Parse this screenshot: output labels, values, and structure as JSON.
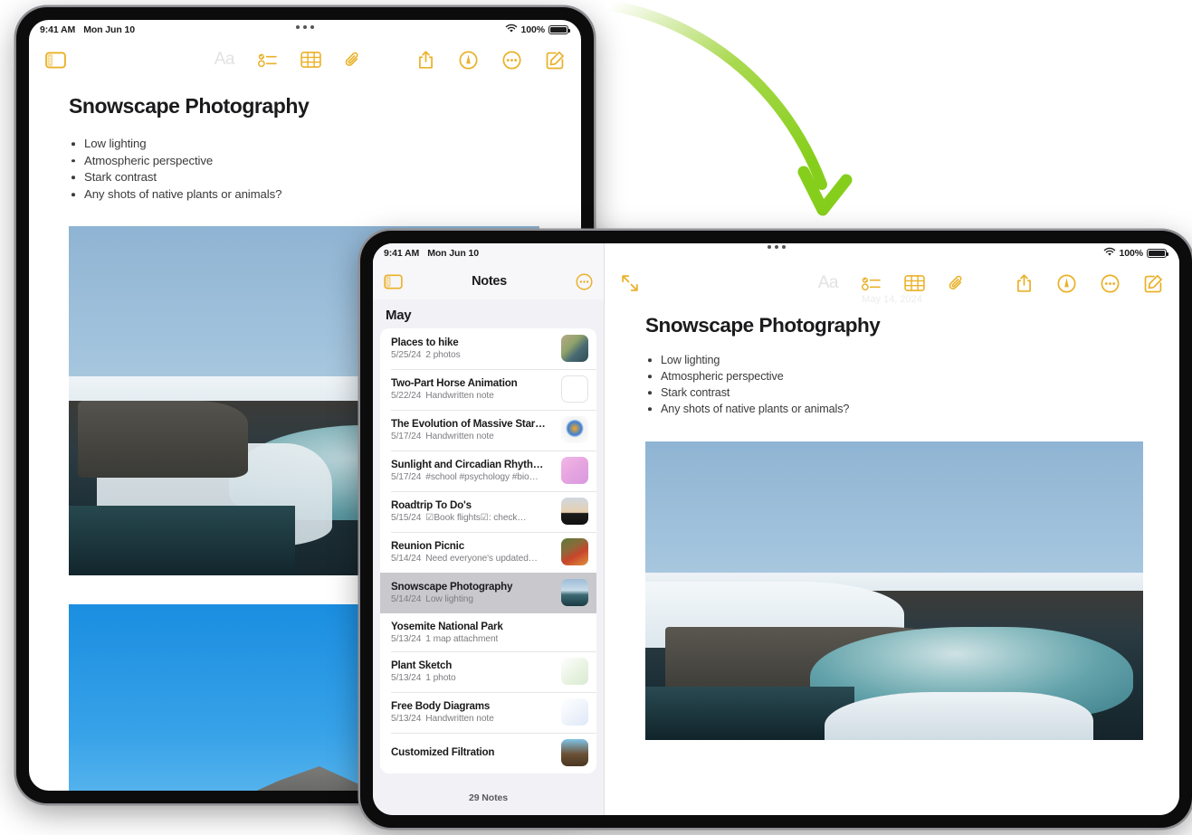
{
  "status_bar": {
    "time": "9:41 AM",
    "date": "Mon Jun 10",
    "battery_percent": "100%",
    "wifi_icon": "wifi-icon",
    "battery_icon": "battery-icon"
  },
  "toolbar": {
    "sidebar_toggle_icon": "sidebar-toggle-icon",
    "expand_icon": "expand-diagonal-icon",
    "format_label": "Aa",
    "checklist_icon": "checklist-icon",
    "table_icon": "table-icon",
    "attachment_icon": "paperclip-icon",
    "share_icon": "share-icon",
    "markup_icon": "markup-pen-icon",
    "more_icon": "more-ellipsis-icon",
    "compose_icon": "compose-icon",
    "ghost_date": "May 14, 2024"
  },
  "note": {
    "title": "Snowscape Photography",
    "bullets": [
      "Low lighting",
      "Atmospheric perspective",
      "Stark contrast",
      "Any shots of native plants or animals?"
    ],
    "photo_1_name": "snowy-canyon-waterfall-photo",
    "photo_2_name": "blue-sky-mountain-peak-photo"
  },
  "notes_pane": {
    "header_title": "Notes",
    "more_icon": "more-ellipsis-circle-icon",
    "section_label": "May",
    "footer": "29 Notes",
    "items": [
      {
        "title": "Places to hike",
        "date": "5/25/24",
        "preview": "2 photos",
        "thumb": "map-photo-thumbnail"
      },
      {
        "title": "Two-Part Horse Animation",
        "date": "5/22/24",
        "preview": "Handwritten note",
        "thumb": "empty-thumbnail"
      },
      {
        "title": "The Evolution of Massive Star…",
        "date": "5/17/24",
        "preview": "Handwritten note",
        "thumb": "star-diagram-thumbnail"
      },
      {
        "title": "Sunlight and Circadian Rhyth…",
        "date": "5/17/24",
        "preview": "#school #psychology #bio…",
        "thumb": "pink-notes-thumbnail"
      },
      {
        "title": "Roadtrip To Do's",
        "date": "5/15/24",
        "preview": "☑Book flights☑: check…",
        "thumb": "sunset-silhouette-thumbnail"
      },
      {
        "title": "Reunion Picnic",
        "date": "5/14/24",
        "preview": "Need everyone's updated…",
        "thumb": "picnic-photo-thumbnail"
      },
      {
        "title": "Snowscape Photography",
        "date": "5/14/24",
        "preview": "Low lighting",
        "thumb": "snowscape-thumbnail",
        "selected": true
      },
      {
        "title": "Yosemite National Park",
        "date": "5/13/24",
        "preview": "1 map attachment",
        "thumb": "none"
      },
      {
        "title": "Plant Sketch",
        "date": "5/13/24",
        "preview": "1 photo",
        "thumb": "plant-sketch-thumbnail"
      },
      {
        "title": "Free Body Diagrams",
        "date": "5/13/24",
        "preview": "Handwritten note",
        "thumb": "diagram-thumbnail"
      },
      {
        "title": "Customized Filtration",
        "date": "",
        "preview": "",
        "thumb": "filtration-thumbnail"
      }
    ]
  },
  "annotation": {
    "arrow_name": "green-curved-arrow",
    "arrow_color_start": "#f2f9e6",
    "arrow_color_end": "#86ce1c"
  }
}
